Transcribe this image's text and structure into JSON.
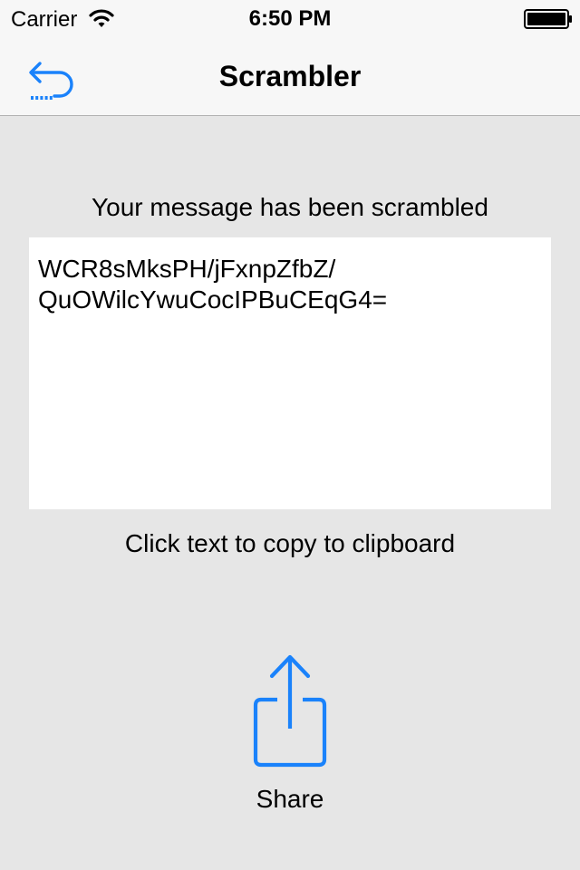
{
  "status_bar": {
    "carrier": "Carrier",
    "time": "6:50 PM",
    "icons": [
      "wifi-icon",
      "battery-icon"
    ]
  },
  "nav_bar": {
    "title": "Scrambler",
    "back_icon": "back-arrow-icon"
  },
  "main": {
    "message_label": "Your message has been scrambled",
    "scrambled_text": "WCR8sMksPH/jFxnpZfbZ/\nQuOWilcYwuCocIPBuCEqG4=",
    "hint_label": "Click text to copy to clipboard",
    "share": {
      "label": "Share",
      "icon": "share-icon"
    }
  },
  "colors": {
    "accent": "#1a82fb",
    "background": "#e6e6e6",
    "bar": "#f7f7f7"
  }
}
